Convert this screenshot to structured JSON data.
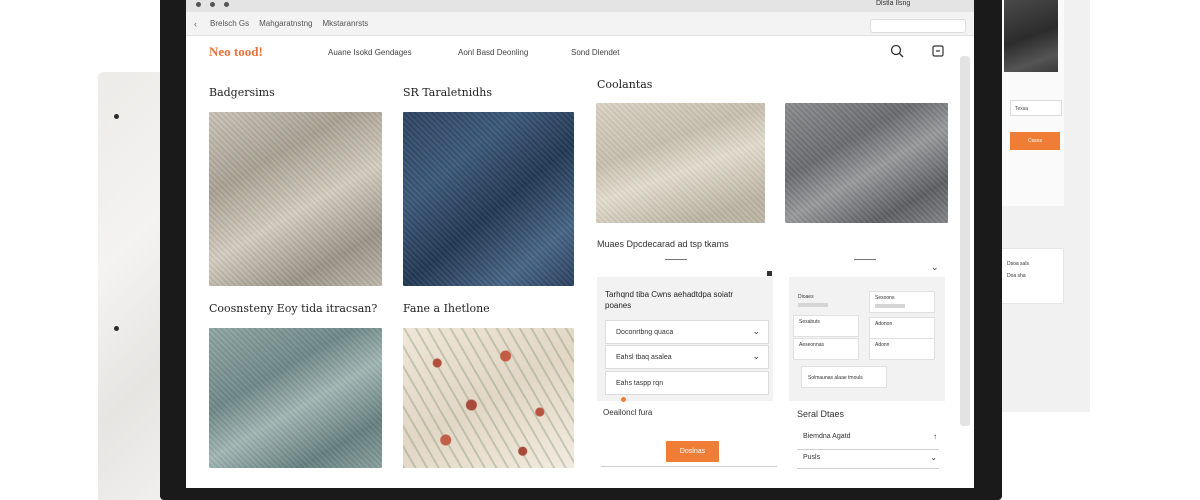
{
  "browser": {
    "tabs": [
      "Brelsch Gs",
      "Mahgaratnstng",
      "Mkstaranrsts"
    ],
    "user_label": "Dlstla Ilsng",
    "url_placeholder": ""
  },
  "site": {
    "logo": "Neo tood!",
    "nav": [
      "Auane Isokd Gendages",
      "Aonl Basd Deonling",
      "Sond Dlendet"
    ]
  },
  "products": [
    {
      "title": "Badgersims",
      "fabric": "linen"
    },
    {
      "title": "SR Taraletnidhs",
      "fabric": "denim"
    },
    {
      "title": "Coolantas",
      "fabric": "beige"
    },
    {
      "title": "",
      "fabric": "grey"
    },
    {
      "title": "Coosnsteny Eoy tida itracsan?",
      "fabric": "sage"
    },
    {
      "title": "Fane a Ihetlone",
      "fabric": "floral"
    }
  ],
  "right_section": {
    "title": "Muaes Dpcdecarad ad tsp tkams",
    "filter": {
      "header": "Tarhqnd tiba Cwns aehadtdpa soiatr poanes",
      "dropdowns": [
        "Doconrtbng quaca",
        "Eahsl tbaq asalea",
        "Eahs taspp rqn"
      ],
      "footer": "Oeailoncl fura"
    },
    "specs": {
      "boxes": [
        "Dioaes",
        "Sesoons",
        "Sesabuts",
        "Adonon",
        "Aeseonnas",
        "Adonn"
      ],
      "cta": "Solmaunas alaae tmouls"
    },
    "button": "Doslnas",
    "list_title": "Seral Dtaes",
    "list": [
      "Biemdna Agatd",
      "Pusls"
    ]
  },
  "side_panel": {
    "field": "Texsa",
    "button": "Cssos",
    "card_rows": [
      "Dsoa sals",
      "Doa sha"
    ]
  },
  "colors": {
    "accent": "#ef7d35",
    "logo": "#e9723a"
  }
}
